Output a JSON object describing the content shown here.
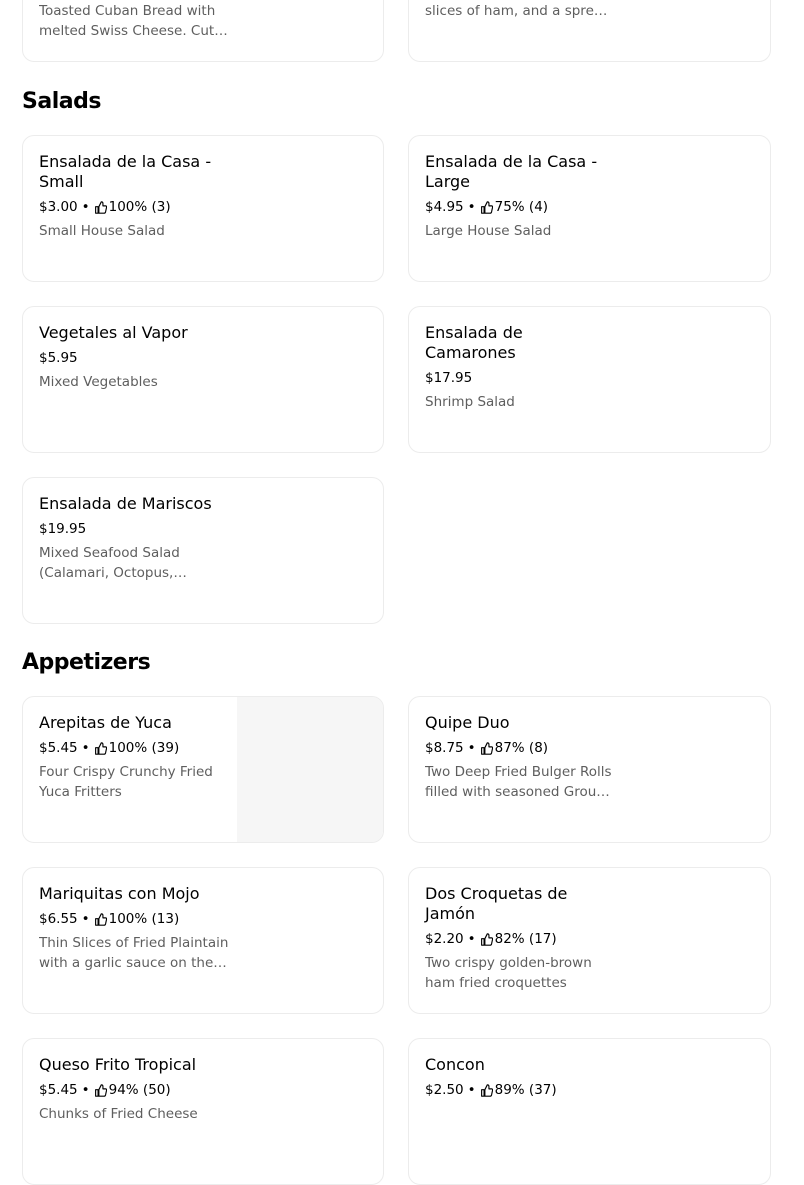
{
  "top_cards": [
    {
      "description": "Toasted Cuban Bread with melted Swiss Cheese. Cut in half."
    },
    {
      "description": "slices of ham, and a spread of butter"
    }
  ],
  "sections": {
    "salads": {
      "title": "Salads",
      "items": [
        {
          "name": "Ensalada de la Casa - Small",
          "price": "$3.00",
          "rating": "100% (3)",
          "description": "Small House Salad"
        },
        {
          "name": "Ensalada de la Casa - Large",
          "price": "$4.95",
          "rating": "75% (4)",
          "description": "Large House Salad"
        },
        {
          "name": "Vegetales al Vapor",
          "price": "$5.95",
          "rating": "",
          "description": "Mixed Vegetables"
        },
        {
          "name": "Ensalada de Camarones",
          "price": "$17.95",
          "rating": "",
          "description": "Shrimp Salad"
        },
        {
          "name": "Ensalada de Mariscos",
          "price": "$19.95",
          "rating": "",
          "description": "Mixed Seafood Salad (Calamari, Octopus, Shrimp)"
        }
      ]
    },
    "appetizers": {
      "title": "Appetizers",
      "items": [
        {
          "name": "Arepitas de Yuca",
          "price": "$5.45",
          "rating": "100% (39)",
          "description": "Four Crispy Crunchy Fried Yuca Fritters"
        },
        {
          "name": "Quipe Duo",
          "price": "$8.75",
          "rating": "87% (8)",
          "description": "Two Deep Fried Bulger Rolls filled with seasoned Ground Beef"
        },
        {
          "name": "Mariquitas con Mojo",
          "price": "$6.55",
          "rating": "100% (13)",
          "description": "Thin Slices of Fried Plaintain with a garlic sauce on the side"
        },
        {
          "name": "Dos Croquetas de Jamón",
          "price": "$2.20",
          "rating": "82% (17)",
          "description": "Two crispy golden-brown ham fried croquettes"
        },
        {
          "name": "Queso Frito Tropical",
          "price": "$5.45",
          "rating": "94% (50)",
          "description": "Chunks of Fried Cheese"
        },
        {
          "name": "Concon",
          "price": "$2.50",
          "rating": "89% (37)",
          "description": ""
        }
      ]
    }
  },
  "separator": "•",
  "icons": {
    "rating": "thumbs-up-icon"
  },
  "colors": {
    "text": "#000000",
    "secondary_text": "#5e5e5e",
    "card_border": "#ececec",
    "image_placeholder": "#f6f6f6"
  }
}
